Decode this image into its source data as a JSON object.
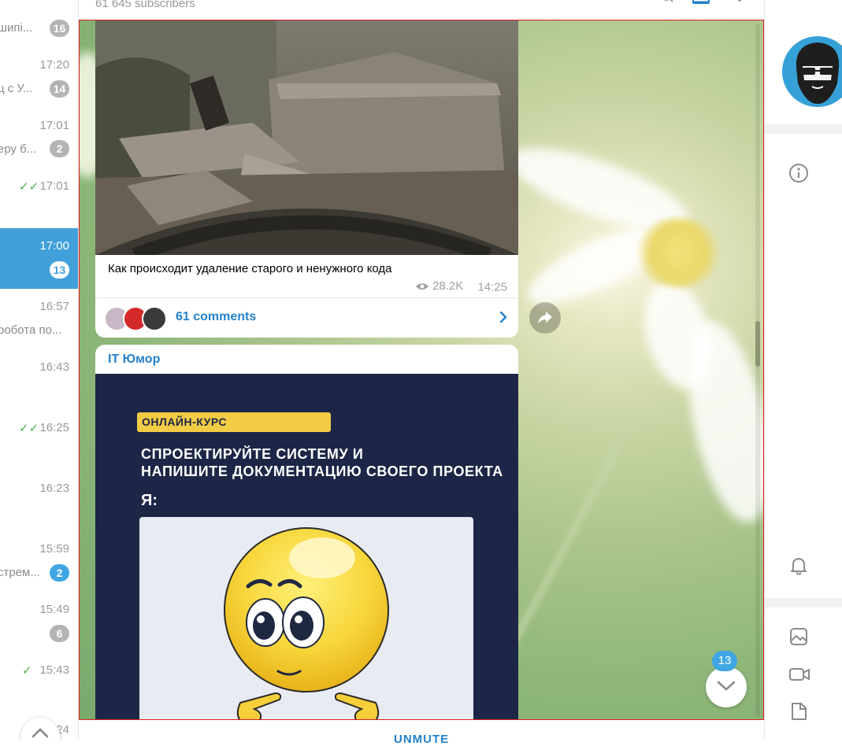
{
  "chat_list": {
    "rows": [
      {
        "time": "",
        "preview": "шипі...",
        "badge": "16",
        "badge_style": "grey"
      },
      {
        "time": "17:20",
        "preview": "ц с У...",
        "badge": "14",
        "badge_style": "grey"
      },
      {
        "time": "17:01",
        "preview": "еру б...",
        "badge": "2",
        "badge_style": "grey"
      },
      {
        "time": "17:01",
        "preview": "",
        "badge": "",
        "sent_check": "✓✓"
      },
      {
        "time": "17:00",
        "preview": "",
        "badge": "13",
        "active": true
      },
      {
        "time": "16:57",
        "preview": "робота по...",
        "badge": ""
      },
      {
        "time": "16:43",
        "preview": "",
        "badge": ""
      },
      {
        "time": "16:25",
        "preview": "",
        "badge": "",
        "sent_check": "✓✓"
      },
      {
        "time": "16:23",
        "preview": "",
        "badge": ""
      },
      {
        "time": "15:59",
        "preview": "стрем...",
        "badge": "2",
        "badge_style": "blue"
      },
      {
        "time": "15:49",
        "preview": "",
        "badge": "6",
        "badge_style": "grey"
      },
      {
        "time": "15:43",
        "preview": "",
        "badge": "",
        "sent_check": "✓"
      },
      {
        "time": "24",
        "preview": "",
        "badge": ""
      }
    ]
  },
  "chat_header": {
    "subscribers": "61 645 subscribers"
  },
  "messages": [
    {
      "type": "video",
      "caption": "Как происходит удаление старого и ненужного кода",
      "views": "28.2K",
      "time": "14:25",
      "comments_label": "61 comments"
    },
    {
      "type": "image",
      "sender": "IT Юмор",
      "poster": {
        "tag": "ОНЛАЙН-КУРС",
        "line1": "СПРОЕКТИРУЙТЕ СИСТЕМУ И",
        "line2": "НАПИШИТЕ ДОКУМЕНТАЦИЮ СВОЕГО ПРОЕКТА",
        "line3": "Я:"
      }
    }
  ],
  "jump_to_bottom": {
    "unread_badge": "13"
  },
  "bottom_bar": {
    "unmute_label": "UNMUTE"
  },
  "colors": {
    "accent": "#2481cc",
    "active_row": "#419fd9",
    "badge_grey": "#b4b4b4",
    "badge_blue": "#3fa6e3",
    "poster_bg": "#1d2646",
    "poster_tag": "#f3cc45",
    "selection_border": "#e02020"
  },
  "icons": {
    "views": "eye-icon",
    "comments_arrow": "chevron-right-icon",
    "share": "share-icon",
    "jump": "chevron-down-icon",
    "info": "info-icon",
    "notifications": "bell-icon",
    "photos": "image-icon",
    "videos": "video-icon",
    "files": "file-icon"
  }
}
